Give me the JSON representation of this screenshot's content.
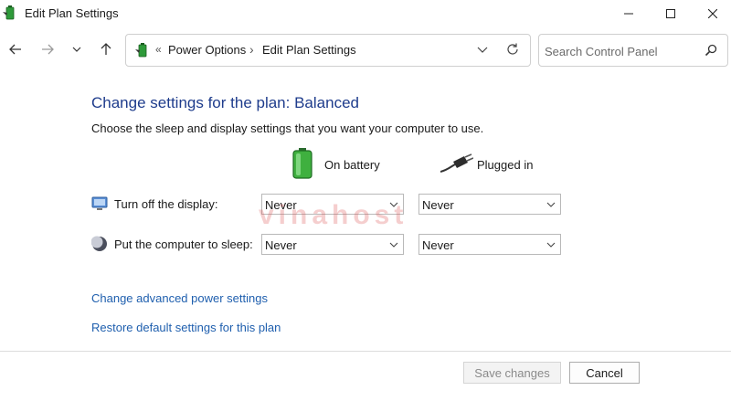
{
  "window": {
    "title": "Edit Plan Settings",
    "icon": "power-options-icon"
  },
  "toolbar": {
    "breadcrumb_sep": "«",
    "breadcrumbs": [
      "Power Options",
      "Edit Plan Settings"
    ],
    "crumb_separator": "›",
    "search_placeholder": "Search Control Panel"
  },
  "main": {
    "heading": "Change settings for the plan: Balanced",
    "subtitle": "Choose the sleep and display settings that you want your computer to use.",
    "columns": {
      "battery": "On battery",
      "plugged": "Plugged in"
    },
    "rows": [
      {
        "label": "Turn off the display:",
        "icon": "monitor-icon",
        "battery": "Never",
        "plugged": "Never"
      },
      {
        "label": "Put the computer to sleep:",
        "icon": "moon-icon",
        "battery": "Never",
        "plugged": "Never"
      }
    ],
    "links": {
      "advanced": "Change advanced power settings",
      "restore": "Restore default settings for this plan"
    }
  },
  "footer": {
    "save_label": "Save changes",
    "cancel_label": "Cancel"
  },
  "watermark": "vinahost",
  "colors": {
    "heading": "#1e3c8c",
    "link": "#1f5fae"
  }
}
